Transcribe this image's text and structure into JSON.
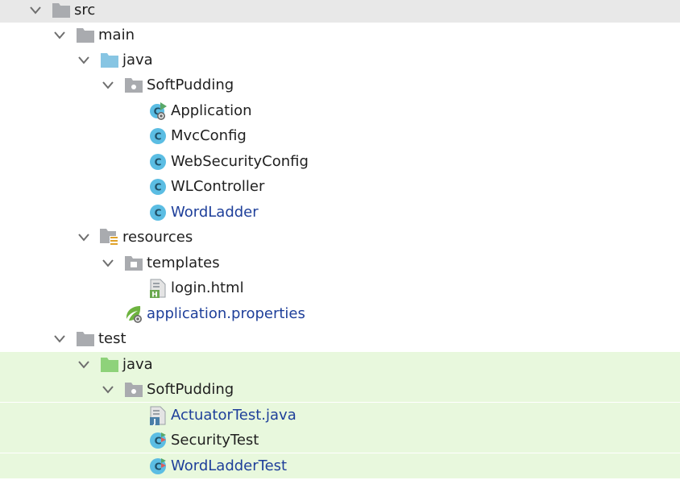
{
  "tree": {
    "src": {
      "label": "src",
      "icon": "folder-icon"
    },
    "main": {
      "label": "main",
      "icon": "folder-icon"
    },
    "main_java": {
      "label": "java",
      "icon": "source-folder-icon"
    },
    "main_softpudding": {
      "label": "SoftPudding",
      "icon": "package-icon"
    },
    "application": {
      "label": "Application",
      "icon": "spring-boot-class-icon"
    },
    "mvcconfig": {
      "label": "MvcConfig",
      "icon": "class-icon"
    },
    "websecurityconfig": {
      "label": "WebSecurityConfig",
      "icon": "class-icon"
    },
    "wlcontroller": {
      "label": "WLController",
      "icon": "class-icon"
    },
    "wordladder": {
      "label": "WordLadder",
      "icon": "class-icon"
    },
    "resources": {
      "label": "resources",
      "icon": "resources-folder-icon"
    },
    "templates": {
      "label": "templates",
      "icon": "folder-icon"
    },
    "login_html": {
      "label": "login.html",
      "icon": "html-file-icon"
    },
    "app_properties": {
      "label": "application.properties",
      "icon": "spring-properties-icon"
    },
    "test": {
      "label": "test",
      "icon": "folder-icon"
    },
    "test_java": {
      "label": "java",
      "icon": "test-source-folder-icon"
    },
    "test_softpudding": {
      "label": "SoftPudding",
      "icon": "package-icon"
    },
    "actuatortest": {
      "label": "ActuatorTest.java",
      "icon": "java-file-icon"
    },
    "securitytest": {
      "label": "SecurityTest",
      "icon": "test-class-icon"
    },
    "wordladdertest": {
      "label": "WordLadderTest",
      "icon": "test-class-icon"
    }
  },
  "colors": {
    "selection": "#e8e8e8",
    "test_background": "#e8f8dd",
    "modified_text": "#1e3f9a",
    "folder": "#a9abaf",
    "source_folder": "#87c5e3",
    "test_folder": "#8ed27a",
    "class_circle": "#5bbde3"
  }
}
